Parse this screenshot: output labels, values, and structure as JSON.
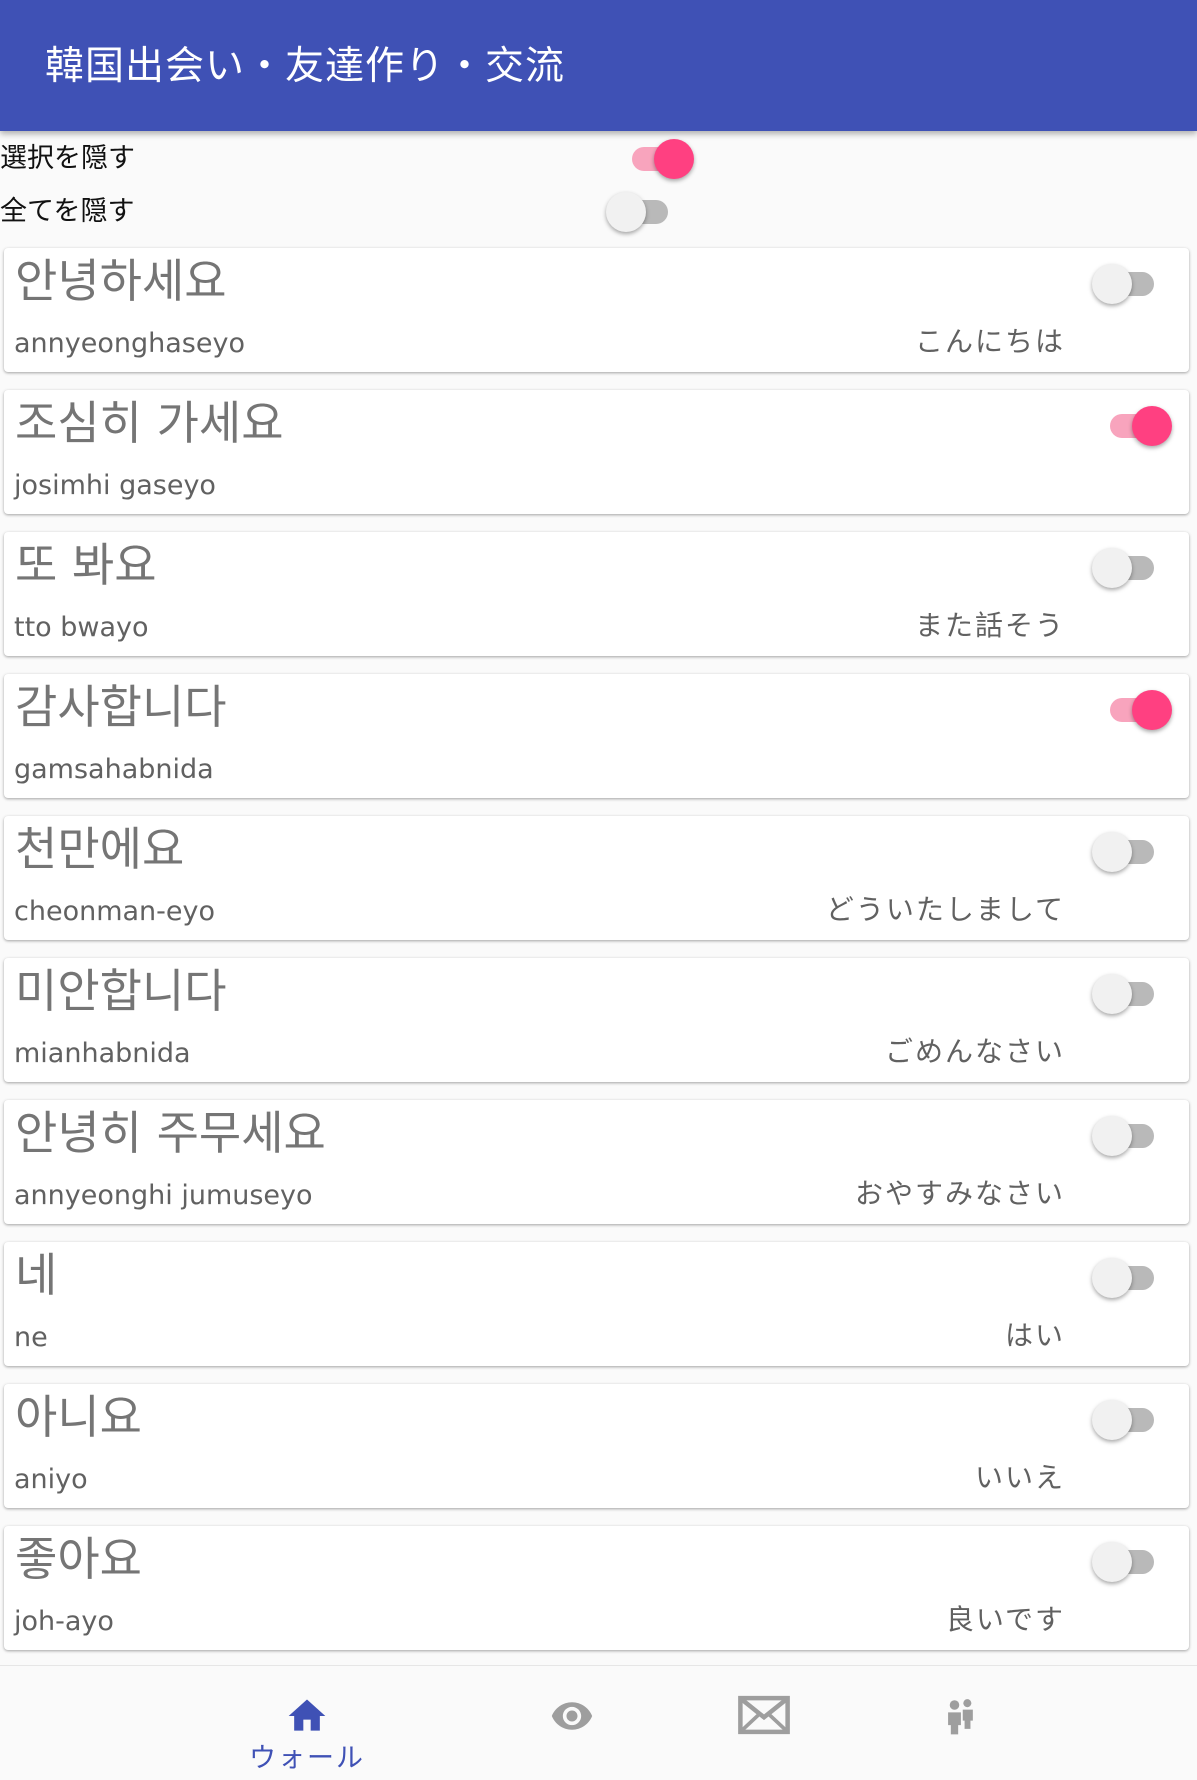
{
  "app_bar": {
    "title": "韓国出会い・友達作り・交流"
  },
  "global_toggles": [
    {
      "label": "選択を隠す",
      "on": true
    },
    {
      "label": "全てを隠す",
      "on": false
    }
  ],
  "phrases": [
    {
      "korean": "안녕하세요",
      "roman": "annyeonghaseyo",
      "japanese": "こんにちは",
      "hidden": false
    },
    {
      "korean": "조심히 가세요",
      "roman": "josimhi gaseyo",
      "japanese": "",
      "hidden": true
    },
    {
      "korean": "또 봐요",
      "roman": "tto bwayo",
      "japanese": "また話そう",
      "hidden": false
    },
    {
      "korean": "감사합니다",
      "roman": "gamsahabnida",
      "japanese": "",
      "hidden": true
    },
    {
      "korean": "천만에요",
      "roman": "cheonman-eyo",
      "japanese": "どういたしまして",
      "hidden": false
    },
    {
      "korean": "미안합니다",
      "roman": "mianhabnida",
      "japanese": "ごめんなさい",
      "hidden": false
    },
    {
      "korean": "안녕히 주무세요",
      "roman": "annyeonghi jumuseyo",
      "japanese": "おやすみなさい",
      "hidden": false
    },
    {
      "korean": "네",
      "roman": "ne",
      "japanese": "はい",
      "hidden": false
    },
    {
      "korean": "아니요",
      "roman": "aniyo",
      "japanese": "いいえ",
      "hidden": false
    },
    {
      "korean": "좋아요",
      "roman": "joh-ayo",
      "japanese": "良いです",
      "hidden": false
    }
  ],
  "bottom_nav": [
    {
      "icon": "home-icon",
      "label": "ウォール",
      "active": true
    },
    {
      "icon": "eye-icon",
      "label": "",
      "active": false
    },
    {
      "icon": "mail-icon",
      "label": "",
      "active": false
    },
    {
      "icon": "people-icon",
      "label": "",
      "active": false
    }
  ],
  "colors": {
    "primary": "#3f51b5",
    "accent": "#ff4081",
    "inactive_icon": "#9e9e9e"
  }
}
